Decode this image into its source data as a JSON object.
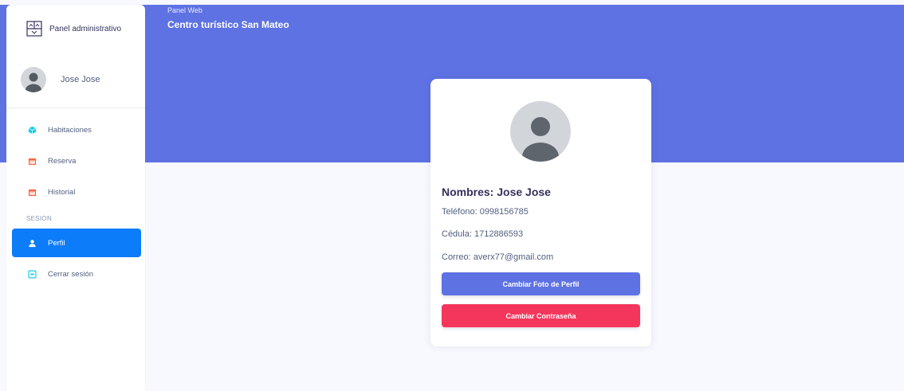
{
  "header": {
    "subtitle": "Panel Web",
    "title": "Centro turístico San Mateo"
  },
  "sidebar": {
    "brand": "Panel administrativo",
    "user_name": "Jose Jose",
    "items": [
      {
        "label": "Habitaciones",
        "icon": "cube-icon",
        "color": "#11cdef"
      },
      {
        "label": "Reserva",
        "icon": "calendar-icon",
        "color": "#fb6340"
      },
      {
        "label": "Historial",
        "icon": "calendar-icon",
        "color": "#fb6340"
      }
    ],
    "section_heading": "SESION",
    "session_items": [
      {
        "label": "Perfil",
        "icon": "user-icon",
        "active": true
      },
      {
        "label": "Cerrar sesión",
        "icon": "logout-icon",
        "color": "#11cdef"
      }
    ]
  },
  "profile": {
    "name_line": "Nombres: Jose Jose",
    "phone_line": "Teléfono: 0998156785",
    "id_line": "Cédula: 1712886593",
    "email_line": "Correo: averx77@gmail.com",
    "change_photo_label": "Cambiar Foto de Perfil",
    "change_password_label": "Cambiar Contraseña"
  },
  "colors": {
    "primary": "#5e72e4",
    "active_nav": "#0c7cf8",
    "danger": "#f5365c",
    "background": "#f8f9fe"
  }
}
